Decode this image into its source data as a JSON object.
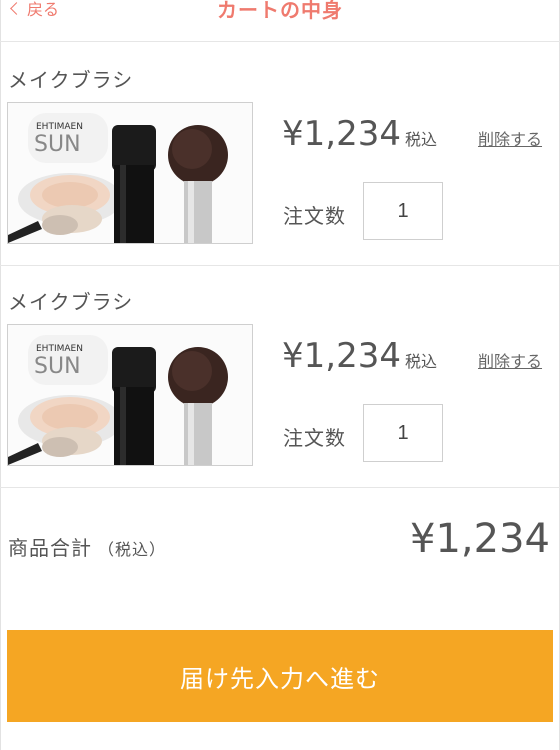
{
  "header": {
    "back_label": "戻る",
    "title": "カートの中身"
  },
  "items": [
    {
      "name": "メイクブラシ",
      "price": "¥1,234",
      "tax_label": "税込",
      "delete_label": "削除する",
      "qty_label": "注文数",
      "qty_value": "1",
      "image_icon": "makeup-brush-product-photo"
    },
    {
      "name": "メイクブラシ",
      "price": "¥1,234",
      "tax_label": "税込",
      "delete_label": "削除する",
      "qty_label": "注文数",
      "qty_value": "1",
      "image_icon": "makeup-brush-product-photo"
    }
  ],
  "total": {
    "label": "商品合計",
    "tax_note": "（税込）",
    "amount": "¥1,234"
  },
  "cta": {
    "label": "届け先入力へ進む"
  },
  "colors": {
    "accent_text": "#ef7a6e",
    "cta_background": "#f5a623"
  }
}
